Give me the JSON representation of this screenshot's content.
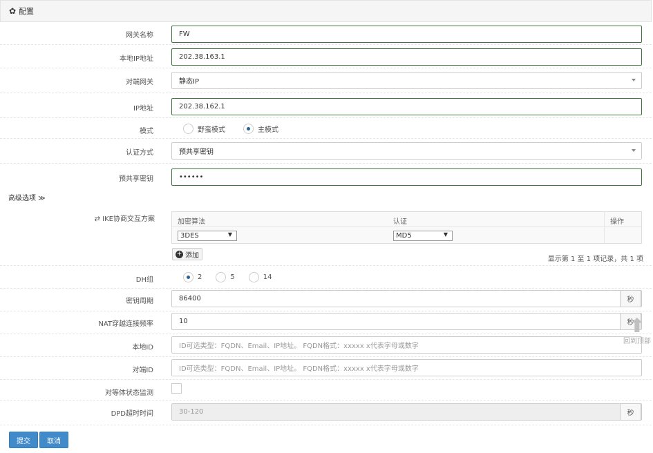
{
  "panel": {
    "title": "配置",
    "icon": "gear-icon"
  },
  "fields": {
    "gateway_name": {
      "label": "网关名称",
      "value": "FW"
    },
    "local_ip": {
      "label": "本地IP地址",
      "value": "202.38.163.1"
    },
    "peer_gateway": {
      "label": "对端网关",
      "value": "静态IP"
    },
    "ip_address": {
      "label": "IP地址",
      "value": "202.38.162.1"
    },
    "mode": {
      "label": "模式",
      "options": [
        "野蛮模式",
        "主模式"
      ],
      "selected": "主模式"
    },
    "auth_method": {
      "label": "认证方式",
      "value": "预共享密钥"
    },
    "psk": {
      "label": "预共享密钥",
      "value": "••••••"
    }
  },
  "advanced": {
    "toggle_label": "高级选项",
    "ike_label": "IKE协商交互方案",
    "ike_table": {
      "headers": [
        "加密算法",
        "认证",
        "操作"
      ],
      "rows": [
        {
          "encryption": "3DES",
          "auth": "MD5"
        }
      ]
    },
    "add_label": "添加",
    "record_info": "显示第 1 至 1 项记录，共 1 项",
    "dh_group": {
      "label": "DH组",
      "options": [
        "2",
        "5",
        "14"
      ],
      "selected": "2"
    },
    "key_period": {
      "label": "密钥周期",
      "value": "86400",
      "unit": "秒"
    },
    "nat_freq": {
      "label": "NAT穿越连接频率",
      "value": "10",
      "unit": "秒"
    },
    "local_id": {
      "label": "本地ID",
      "placeholder": "ID可选类型：FQDN、Email、IP地址。 FQDN格式：xxxxx x代表字母或数字"
    },
    "peer_id": {
      "label": "对端ID",
      "placeholder": "ID可选类型：FQDN、Email、IP地址。 FQDN格式：xxxxx x代表字母或数字"
    },
    "peer_monitor": {
      "label": "对等体状态监测",
      "checked": false
    },
    "dpd_timeout": {
      "label": "DPD超时时间",
      "placeholder": "30-120",
      "unit": "秒"
    }
  },
  "actions": {
    "submit": "提交",
    "cancel": "取消"
  },
  "back_to_top": "回到顶部",
  "colors": {
    "primary": "#428bca",
    "valid_border": "#3c763d"
  }
}
